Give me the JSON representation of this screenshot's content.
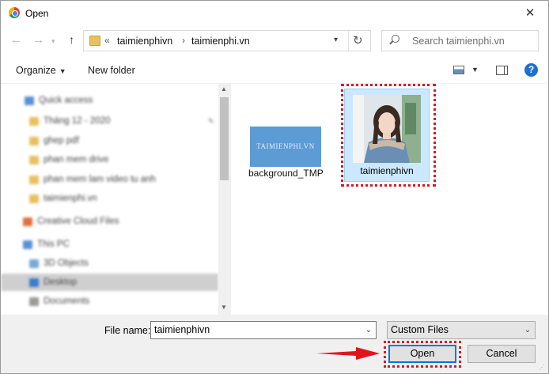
{
  "window": {
    "title": "Open"
  },
  "nav": {
    "breadcrumb": [
      "taimienphivn",
      "taimienphi.vn"
    ],
    "search_placeholder": "Search taimienphi.vn"
  },
  "toolbar": {
    "organize": "Organize",
    "new_folder": "New folder",
    "help": "?"
  },
  "sidebar": {
    "items": [
      {
        "label": "Quick access",
        "icon": "star-icon",
        "color": "#5b8fd6"
      },
      {
        "label": "Tháng 12 - 2020",
        "icon": "folder-icon",
        "color": "#e8c060"
      },
      {
        "label": "ghep pdf",
        "icon": "folder-icon",
        "color": "#e8c060"
      },
      {
        "label": "phan mem drive",
        "icon": "folder-icon",
        "color": "#e8c060"
      },
      {
        "label": "phan mem lam video tu anh",
        "icon": "folder-icon",
        "color": "#e8c060"
      },
      {
        "label": "taimienphi.vn",
        "icon": "folder-icon",
        "color": "#e8c060"
      },
      {
        "label": "Creative Cloud Files",
        "icon": "cloud-icon",
        "color": "#e07040"
      },
      {
        "label": "This PC",
        "icon": "computer-icon",
        "color": "#5b8fd6"
      },
      {
        "label": "3D Objects",
        "icon": "cube-icon",
        "color": "#7aa8d8"
      },
      {
        "label": "Desktop",
        "icon": "desktop-icon",
        "color": "#3a7cc8"
      },
      {
        "label": "Documents",
        "icon": "documents-icon",
        "color": "#9a9a9a"
      }
    ]
  },
  "files": [
    {
      "name": "background_TMP",
      "thumb_text": "TAIMIENPHI.VN",
      "selected": false
    },
    {
      "name": "taimienphivn",
      "selected": true
    }
  ],
  "bottom": {
    "file_name_label": "File name:",
    "file_name_value": "taimienphivn",
    "filter": "Custom Files",
    "open": "Open",
    "cancel": "Cancel"
  },
  "colors": {
    "accent": "#0078d7",
    "highlight": "#e0141e",
    "selection": "#cce8ff"
  }
}
